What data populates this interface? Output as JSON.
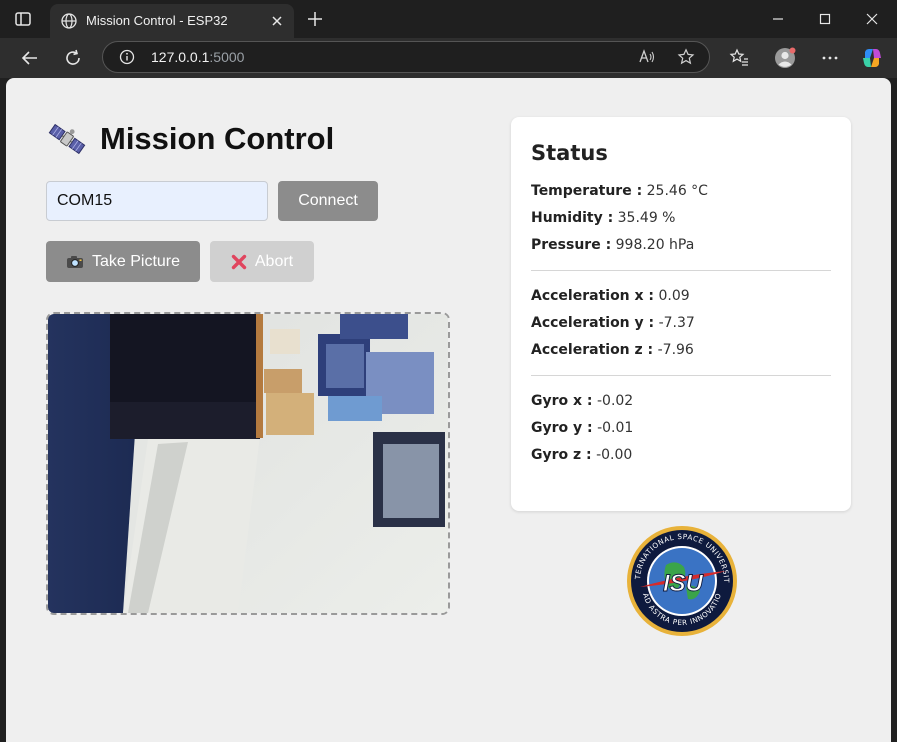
{
  "browser": {
    "tab_title": "Mission Control - ESP32",
    "url_host": "127.0.0.1",
    "url_path": ":5000"
  },
  "page": {
    "title": "Mission Control",
    "port_value": "COM15",
    "connect_label": "Connect",
    "take_picture_label": "Take Picture",
    "abort_label": "Abort",
    "take_picture_icon": "camera-icon",
    "abort_icon": "cross-mark-icon"
  },
  "status": {
    "heading": "Status",
    "environment": [
      {
        "label": "Temperature :",
        "value": "25.46 °C"
      },
      {
        "label": "Humidity :",
        "value": "35.49 %"
      },
      {
        "label": "Pressure :",
        "value": "998.20 hPa"
      }
    ],
    "acceleration": [
      {
        "label": "Acceleration x :",
        "value": "0.09"
      },
      {
        "label": "Acceleration y :",
        "value": "-7.37"
      },
      {
        "label": "Acceleration z :",
        "value": "-7.96"
      }
    ],
    "gyro": [
      {
        "label": "Gyro x :",
        "value": "-0.02"
      },
      {
        "label": "Gyro y :",
        "value": "-0.01"
      },
      {
        "label": "Gyro z :",
        "value": "-0.00"
      }
    ]
  },
  "logo": {
    "ring_top": "INTERNATIONAL SPACE UNIVERSITY",
    "ring_bottom": "AD ASTRA PER INNOVATIO",
    "center": "ISU"
  },
  "colors": {
    "button_gray": "#8c8c8c",
    "abort_disabled": "#d0d0d0",
    "input_bg": "#e8f0fe",
    "logo_gold": "#e8b23a",
    "logo_navy": "#0e1a3e"
  }
}
